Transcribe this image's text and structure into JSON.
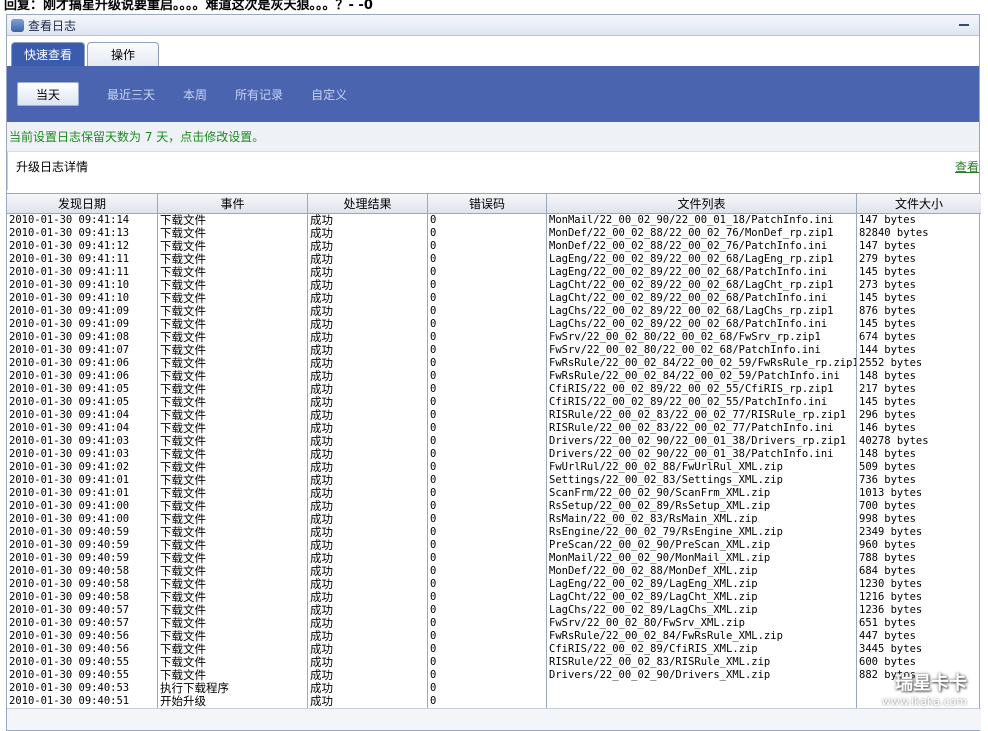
{
  "caption": "回复：刚才搞星升级说要重启。。。。难道这次是灰天狼。。。？- -0",
  "window": {
    "title": "查看日志"
  },
  "tabs": [
    "快速查看",
    "操作"
  ],
  "filters": {
    "active": "当天",
    "links": [
      "最近三天",
      "本周",
      "所有记录",
      "自定义"
    ]
  },
  "notice": "当前设置日志保留天数为 7 天，点击修改设置。",
  "panel": {
    "title": "升级日志详情",
    "link": "查看"
  },
  "table": {
    "headers": [
      "发现日期",
      "事件",
      "处理结果",
      "错误码",
      "文件列表",
      "文件大小"
    ],
    "rows": [
      [
        "2010-01-30 09:41:14",
        "下载文件",
        "成功",
        "0",
        "MonMail/22_00_02_90/22_00_01_18/PatchInfo.ini",
        "147 bytes"
      ],
      [
        "2010-01-30 09:41:13",
        "下载文件",
        "成功",
        "0",
        "MonDef/22_00_02_88/22_00_02_76/MonDef_rp.zip1",
        "82840 bytes"
      ],
      [
        "2010-01-30 09:41:12",
        "下载文件",
        "成功",
        "0",
        "MonDef/22_00_02_88/22_00_02_76/PatchInfo.ini",
        "147 bytes"
      ],
      [
        "2010-01-30 09:41:11",
        "下载文件",
        "成功",
        "0",
        "LagEng/22_00_02_89/22_00_02_68/LagEng_rp.zip1",
        "279 bytes"
      ],
      [
        "2010-01-30 09:41:11",
        "下载文件",
        "成功",
        "0",
        "LagEng/22_00_02_89/22_00_02_68/PatchInfo.ini",
        "145 bytes"
      ],
      [
        "2010-01-30 09:41:10",
        "下载文件",
        "成功",
        "0",
        "LagCht/22_00_02_89/22_00_02_68/LagCht_rp.zip1",
        "273 bytes"
      ],
      [
        "2010-01-30 09:41:10",
        "下载文件",
        "成功",
        "0",
        "LagCht/22_00_02_89/22_00_02_68/PatchInfo.ini",
        "145 bytes"
      ],
      [
        "2010-01-30 09:41:09",
        "下载文件",
        "成功",
        "0",
        "LagChs/22_00_02_89/22_00_02_68/LagChs_rp.zip1",
        "876 bytes"
      ],
      [
        "2010-01-30 09:41:09",
        "下载文件",
        "成功",
        "0",
        "LagChs/22_00_02_89/22_00_02_68/PatchInfo.ini",
        "145 bytes"
      ],
      [
        "2010-01-30 09:41:08",
        "下载文件",
        "成功",
        "0",
        "FwSrv/22_00_02_80/22_00_02_68/FwSrv_rp.zip1",
        "674 bytes"
      ],
      [
        "2010-01-30 09:41:07",
        "下载文件",
        "成功",
        "0",
        "FwSrv/22_00_02_80/22_00_02_68/PatchInfo.ini",
        "144 bytes"
      ],
      [
        "2010-01-30 09:41:06",
        "下载文件",
        "成功",
        "0",
        "FwRsRule/22_00_02_84/22_00_02_59/FwRsRule_rp.zip1",
        "2552 bytes"
      ],
      [
        "2010-01-30 09:41:06",
        "下载文件",
        "成功",
        "0",
        "FwRsRule/22_00_02_84/22_00_02_59/PatchInfo.ini",
        "148 bytes"
      ],
      [
        "2010-01-30 09:41:05",
        "下载文件",
        "成功",
        "0",
        "CfiRIS/22_00_02_89/22_00_02_55/CfiRIS_rp.zip1",
        "217 bytes"
      ],
      [
        "2010-01-30 09:41:05",
        "下载文件",
        "成功",
        "0",
        "CfiRIS/22_00_02_89/22_00_02_55/PatchInfo.ini",
        "145 bytes"
      ],
      [
        "2010-01-30 09:41:04",
        "下载文件",
        "成功",
        "0",
        "RISRule/22_00_02_83/22_00_02_77/RISRule_rp.zip1",
        "296 bytes"
      ],
      [
        "2010-01-30 09:41:04",
        "下载文件",
        "成功",
        "0",
        "RISRule/22_00_02_83/22_00_02_77/PatchInfo.ini",
        "146 bytes"
      ],
      [
        "2010-01-30 09:41:03",
        "下载文件",
        "成功",
        "0",
        "Drivers/22_00_02_90/22_00_01_38/Drivers_rp.zip1",
        "40278 bytes"
      ],
      [
        "2010-01-30 09:41:03",
        "下载文件",
        "成功",
        "0",
        "Drivers/22_00_02_90/22_00_01_38/PatchInfo.ini",
        "148 bytes"
      ],
      [
        "2010-01-30 09:41:02",
        "下载文件",
        "成功",
        "0",
        "FwUrlRul/22_00_02_88/FwUrlRul_XML.zip",
        "509 bytes"
      ],
      [
        "2010-01-30 09:41:01",
        "下载文件",
        "成功",
        "0",
        "Settings/22_00_02_83/Settings_XML.zip",
        "736 bytes"
      ],
      [
        "2010-01-30 09:41:01",
        "下载文件",
        "成功",
        "0",
        "ScanFrm/22_00_02_90/ScanFrm_XML.zip",
        "1013 bytes"
      ],
      [
        "2010-01-30 09:41:00",
        "下载文件",
        "成功",
        "0",
        "RsSetup/22_00_02_89/RsSetup_XML.zip",
        "700 bytes"
      ],
      [
        "2010-01-30 09:41:00",
        "下载文件",
        "成功",
        "0",
        "RsMain/22_00_02_83/RsMain_XML.zip",
        "998 bytes"
      ],
      [
        "2010-01-30 09:40:59",
        "下载文件",
        "成功",
        "0",
        "RsEngine/22_00_02_79/RsEngine_XML.zip",
        "2349 bytes"
      ],
      [
        "2010-01-30 09:40:59",
        "下载文件",
        "成功",
        "0",
        "PreScan/22_00_02_90/PreScan_XML.zip",
        "960 bytes"
      ],
      [
        "2010-01-30 09:40:59",
        "下载文件",
        "成功",
        "0",
        "MonMail/22_00_02_90/MonMail_XML.zip",
        "788 bytes"
      ],
      [
        "2010-01-30 09:40:58",
        "下载文件",
        "成功",
        "0",
        "MonDef/22_00_02_88/MonDef_XML.zip",
        "684 bytes"
      ],
      [
        "2010-01-30 09:40:58",
        "下载文件",
        "成功",
        "0",
        "LagEng/22_00_02_89/LagEng_XML.zip",
        "1230 bytes"
      ],
      [
        "2010-01-30 09:40:58",
        "下载文件",
        "成功",
        "0",
        "LagCht/22_00_02_89/LagCht_XML.zip",
        "1216 bytes"
      ],
      [
        "2010-01-30 09:40:57",
        "下载文件",
        "成功",
        "0",
        "LagChs/22_00_02_89/LagChs_XML.zip",
        "1236 bytes"
      ],
      [
        "2010-01-30 09:40:57",
        "下载文件",
        "成功",
        "0",
        "FwSrv/22_00_02_80/FwSrv_XML.zip",
        "651 bytes"
      ],
      [
        "2010-01-30 09:40:56",
        "下载文件",
        "成功",
        "0",
        "FwRsRule/22_00_02_84/FwRsRule_XML.zip",
        "447 bytes"
      ],
      [
        "2010-01-30 09:40:56",
        "下载文件",
        "成功",
        "0",
        "CfiRIS/22_00_02_89/CfiRIS_XML.zip",
        "3445 bytes"
      ],
      [
        "2010-01-30 09:40:55",
        "下载文件",
        "成功",
        "0",
        "RISRule/22_00_02_83/RISRule_XML.zip",
        "600 bytes"
      ],
      [
        "2010-01-30 09:40:55",
        "下载文件",
        "成功",
        "0",
        "Drivers/22_00_02_90/Drivers_XML.zip",
        "882 bytes"
      ],
      [
        "2010-01-30 09:40:53",
        "执行下载程序",
        "成功",
        "0",
        "",
        ""
      ],
      [
        "2010-01-30 09:40:51",
        "开始升级",
        "成功",
        "0",
        "",
        ""
      ]
    ]
  },
  "watermark": {
    "title": "瑞星卡卡",
    "url": "www.ikaka.com"
  }
}
